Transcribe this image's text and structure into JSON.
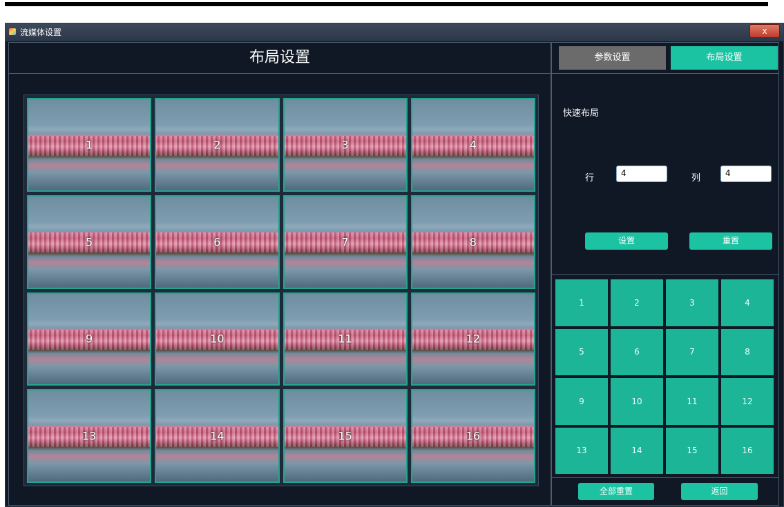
{
  "window": {
    "title": "流媒体设置",
    "close_label": "x"
  },
  "main": {
    "title": "布局设置",
    "cells": [
      "1",
      "2",
      "3",
      "4",
      "5",
      "6",
      "7",
      "8",
      "9",
      "10",
      "11",
      "12",
      "13",
      "14",
      "15",
      "16"
    ]
  },
  "side": {
    "tabs": [
      "参数设置",
      "布局设置"
    ],
    "quick_layout_label": "快速布局",
    "rows_label": "行",
    "rows_value": "4",
    "cols_label": "列",
    "cols_value": "4",
    "set_label": "设置",
    "reset_label": "重置",
    "picker": [
      "1",
      "2",
      "3",
      "4",
      "5",
      "6",
      "7",
      "8",
      "9",
      "10",
      "11",
      "12",
      "13",
      "14",
      "15",
      "16"
    ],
    "reset_all_label": "全部重置",
    "back_label": "返回"
  },
  "colors": {
    "accent": "#1cc3a3",
    "panel_bg": "#101826",
    "inactive_tab": "#6b6b6b"
  }
}
